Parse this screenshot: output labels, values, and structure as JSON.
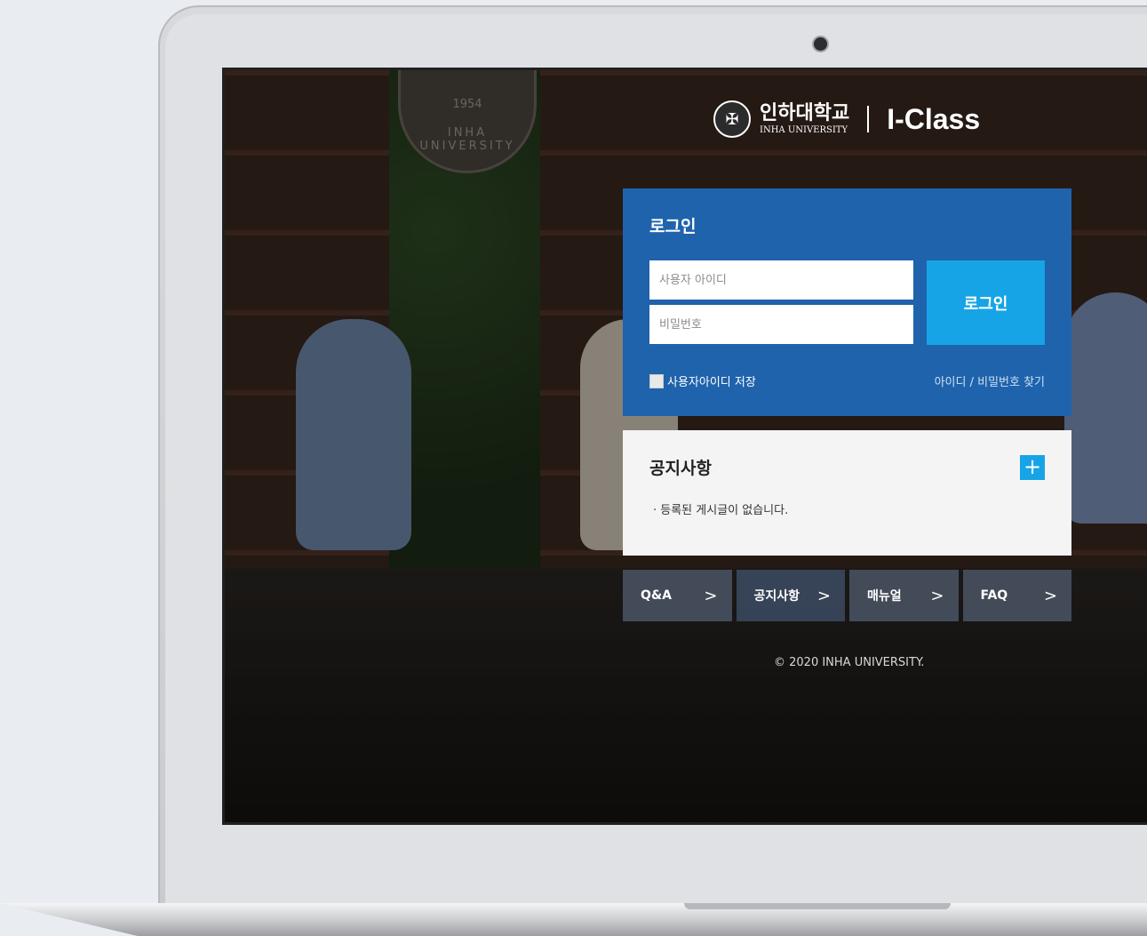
{
  "header": {
    "logo_kr": "인하대학교",
    "logo_en": "INHA UNIVERSITY",
    "product": "I-Class",
    "emblem_text": "INHA UNIVERSITY",
    "emblem_year": "1954"
  },
  "login": {
    "title": "로그인",
    "id_placeholder": "사용자 아이디",
    "pw_placeholder": "비밀번호",
    "button": "로그인",
    "remember_label": "사용자아이디 저장",
    "find_link": "아이디 / 비밀번호 찾기"
  },
  "notice": {
    "title": "공지사항",
    "more": "+",
    "empty_message": "· 등록된 게시글이 없습니다."
  },
  "quicklinks": [
    {
      "label": "Q&A",
      "chevron": ">"
    },
    {
      "label": "공지사항",
      "chevron": ">"
    },
    {
      "label": "매뉴얼",
      "chevron": ">"
    },
    {
      "label": "FAQ",
      "chevron": ">"
    }
  ],
  "footer": {
    "copyright": "© 2020 INHA UNIVERSITY."
  },
  "colors": {
    "login_panel": "#1f63ac",
    "login_button": "#17a4e6",
    "notice_panel": "#f4f4f4"
  }
}
